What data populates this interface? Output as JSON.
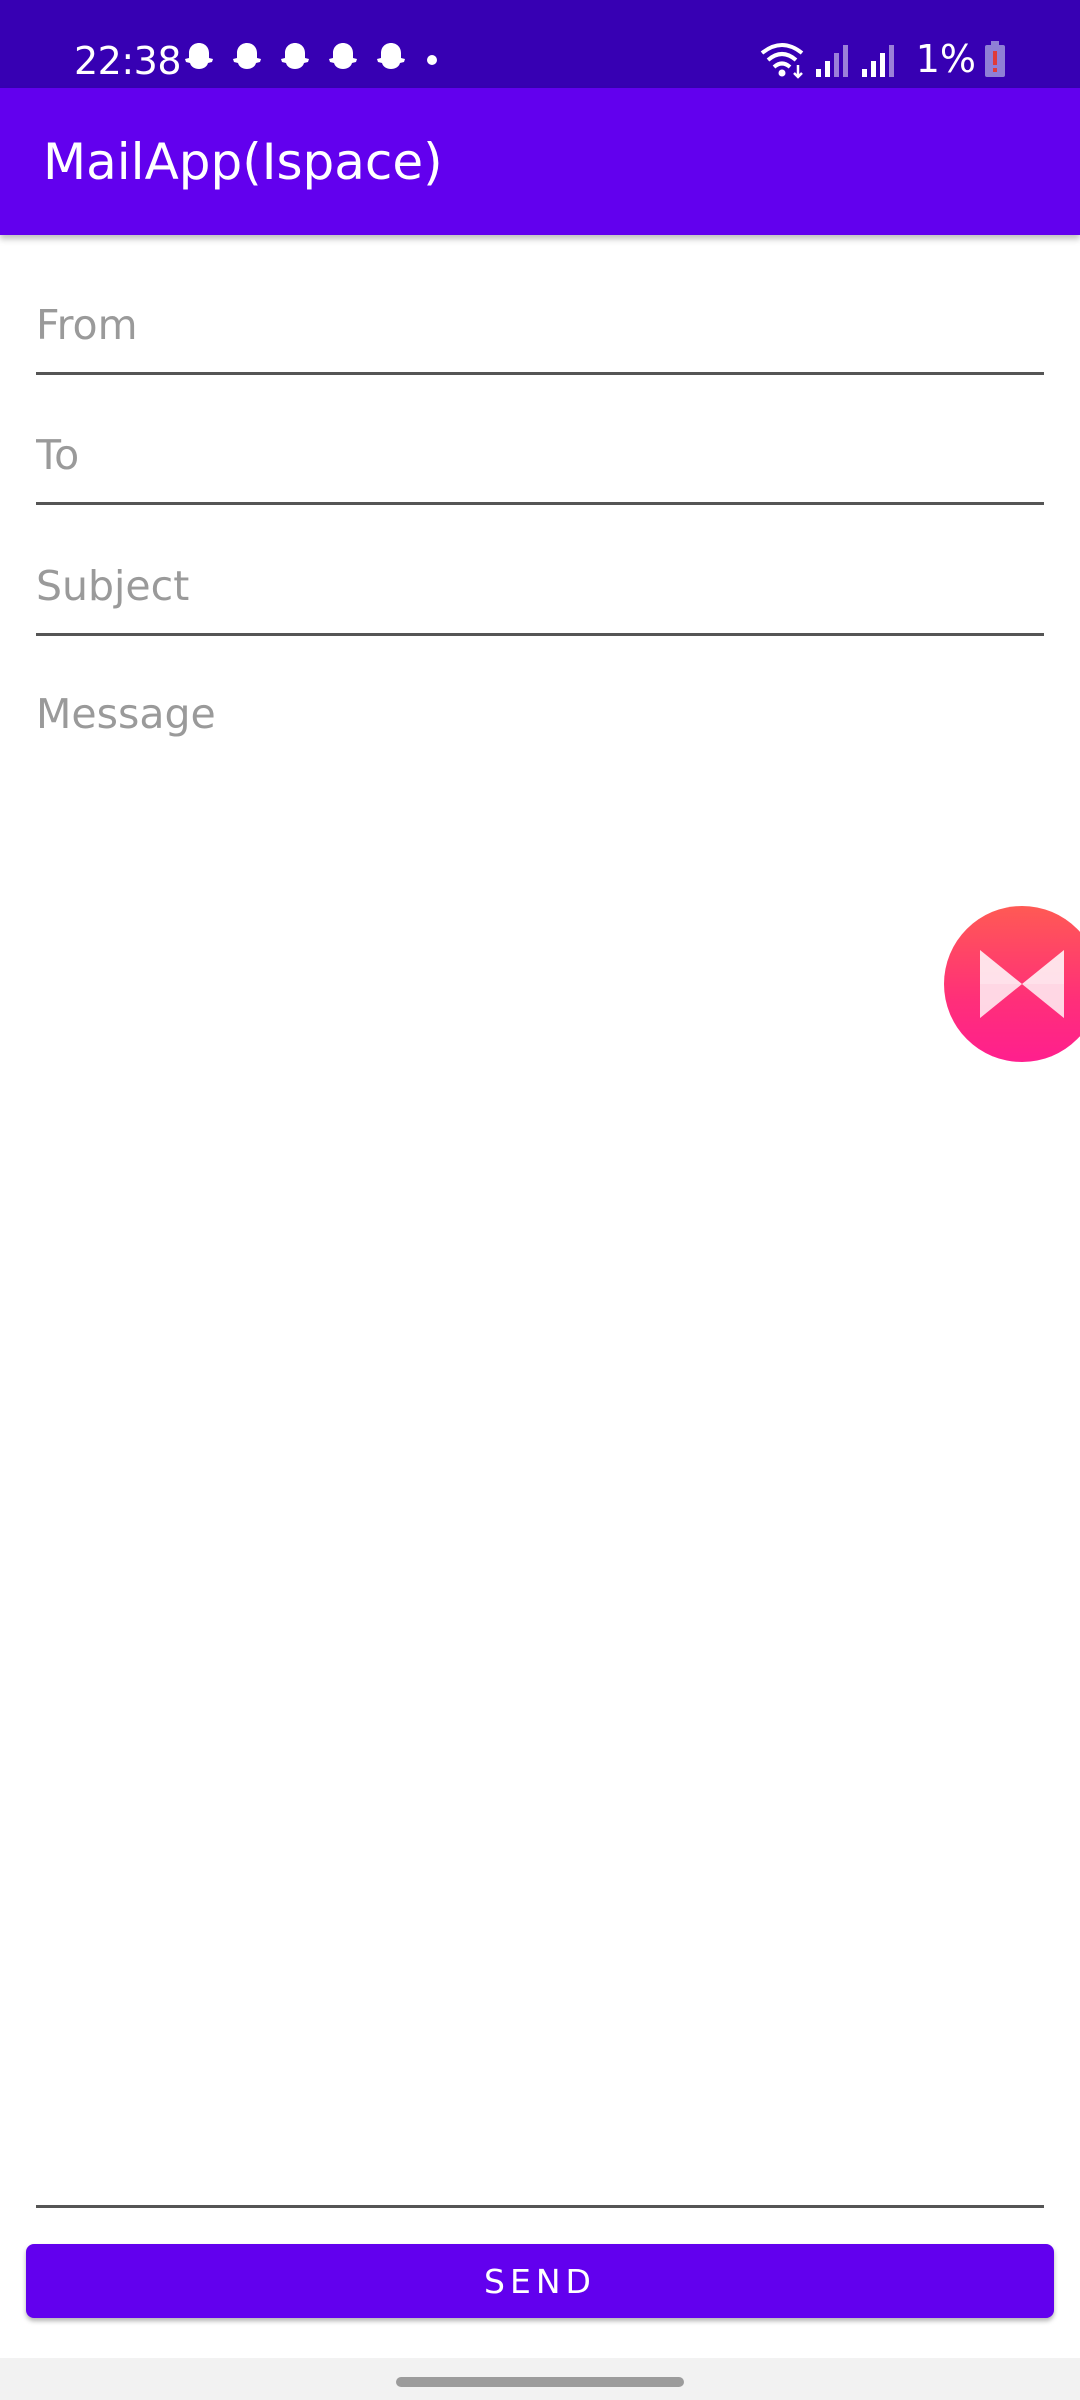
{
  "status_bar": {
    "time": "22:38",
    "battery": "1%",
    "notification_icons": [
      "snapchat-icon",
      "snapchat-icon",
      "snapchat-icon",
      "snapchat-icon",
      "snapchat-icon",
      "dot-icon"
    ],
    "system_icons": [
      "wifi-icon",
      "signal-icon",
      "signal-icon",
      "battery-icon"
    ],
    "background_color": "#3700b3"
  },
  "app_bar": {
    "title": "MailApp(Ispace)",
    "background_color": "#6200ee"
  },
  "form": {
    "from": {
      "placeholder": "From",
      "value": ""
    },
    "to": {
      "placeholder": "To",
      "value": ""
    },
    "subject": {
      "placeholder": "Subject",
      "value": ""
    },
    "message": {
      "placeholder": "Message",
      "value": ""
    }
  },
  "send_button": {
    "label": "SEND",
    "color": "#6200ee"
  },
  "floating_bubble": {
    "icon": "musixmatch-icon"
  }
}
